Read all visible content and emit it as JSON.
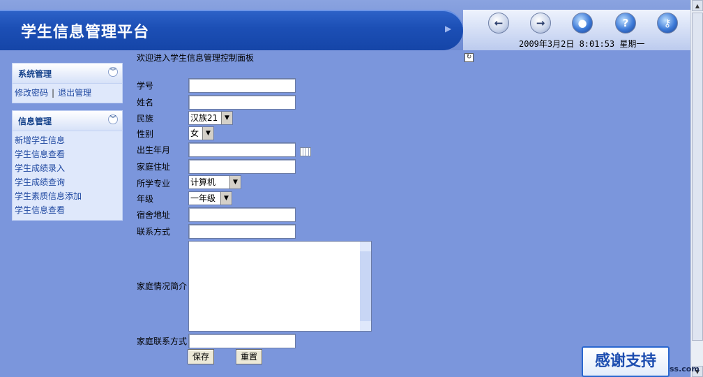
{
  "header": {
    "title": "学生信息管理平台",
    "datetime": "2009年3月2日  8:01:53  星期一",
    "nav_icons": [
      "back-icon",
      "forward-icon",
      "home-globe-icon",
      "help-icon",
      "key-icon"
    ]
  },
  "sidebar": {
    "system": {
      "title": "系统管理",
      "links": [
        "修改密码",
        "退出管理"
      ],
      "separator": "|"
    },
    "info": {
      "title": "信息管理",
      "links": [
        "新增学生信息",
        "学生信息查看",
        "学生成绩录入",
        "学生成绩查询",
        "学生素质信息添加",
        "学生信息查看"
      ]
    }
  },
  "main": {
    "welcome": "欢迎进入学生信息管理控制面板",
    "form": {
      "student_id": {
        "label": "学号",
        "value": ""
      },
      "name": {
        "label": "姓名",
        "value": ""
      },
      "ethnicity": {
        "label": "民族",
        "selected": "汉族21"
      },
      "gender": {
        "label": "性别",
        "selected": "女"
      },
      "birth": {
        "label": "出生年月",
        "value": ""
      },
      "address": {
        "label": "家庭住址",
        "value": ""
      },
      "major": {
        "label": "所学专业",
        "selected": "计算机"
      },
      "grade": {
        "label": "年级",
        "selected": "一年级"
      },
      "dorm": {
        "label": "宿舍地址",
        "value": ""
      },
      "contact": {
        "label": "联系方式",
        "value": ""
      },
      "family_intro": {
        "label": "家庭情况简介",
        "value": ""
      },
      "family_contact": {
        "label": "家庭联系方式",
        "value": ""
      }
    },
    "buttons": {
      "save": "保存",
      "reset": "重置"
    }
  },
  "footer": {
    "thanks": "感谢支持",
    "domain_fragment": "ss.com"
  },
  "colors": {
    "background": "#7b96dc",
    "banner": "#1c4fb5",
    "link": "#1e47a0"
  }
}
